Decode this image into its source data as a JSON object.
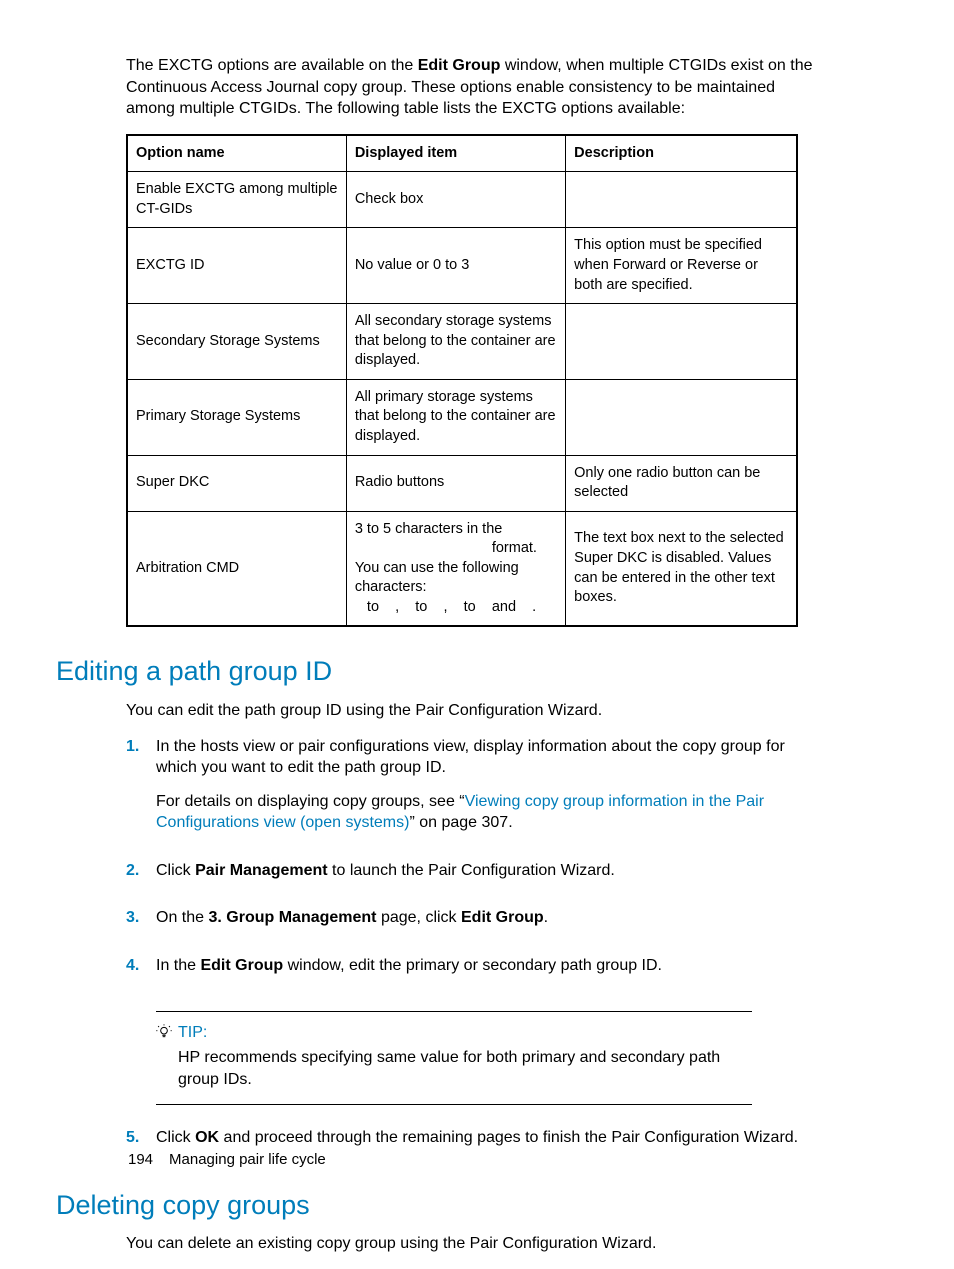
{
  "intro": {
    "line1_prefix": "The EXCTG options are available on the ",
    "line1_bold": "Edit Group",
    "line1_suffix": " window, when multiple CTGIDs exist on the Continuous Access Journal copy group. These options enable consistency to be maintained among multiple CTGIDs. The following table lists the EXCTG options available:"
  },
  "table": {
    "headers": {
      "c1": "Option name",
      "c2": "Displayed item",
      "c3": "Description"
    },
    "rows": [
      {
        "c1": "Enable EXCTG among multiple CT-GIDs",
        "c2": "Check box",
        "c3": ""
      },
      {
        "c1": "EXCTG ID",
        "c2": "No value or 0 to 3",
        "c3": "This option must be specified when Forward or Reverse or both are specified."
      },
      {
        "c1": "Secondary Storage Systems",
        "c2": "All secondary storage systems that belong to the container are displayed.",
        "c3": ""
      },
      {
        "c1": "Primary Storage Systems",
        "c2": "All primary storage systems that belong to the container are displayed.",
        "c3": ""
      },
      {
        "c1": "Super DKC",
        "c2": "Radio buttons",
        "c3": "Only one radio button can be selected"
      },
      {
        "c1": "Arbitration CMD",
        "c2": "3 to 5 characters in the\n                                  format. You can use the following characters:\n   to    ,    to    ,    to    and    .",
        "c3": "The text box next to the selected Super DKC is disabled. Values can be entered in the other text boxes."
      }
    ]
  },
  "section1": {
    "title": "Editing a path group ID",
    "intro": "You can edit the path group ID using the Pair Configuration Wizard.",
    "steps": {
      "s1": "In the hosts view or pair configurations view, display information about the copy group for which you want to edit the path group ID.",
      "s1b_prefix": "For details on displaying copy groups, see “",
      "s1b_link": "Viewing copy group information in the Pair Configurations view (open systems)",
      "s1b_suffix": "” on page 307.",
      "s2_prefix": "Click ",
      "s2_bold": "Pair Management",
      "s2_suffix": " to launch the Pair Configuration Wizard.",
      "s3_prefix": "On the ",
      "s3_bold1": "3. Group Management",
      "s3_mid": " page, click ",
      "s3_bold2": "Edit Group",
      "s3_suffix": ".",
      "s4_prefix": "In the ",
      "s4_bold": "Edit Group",
      "s4_suffix": " window, edit the primary or secondary path group ID.",
      "s5_prefix": "Click ",
      "s5_bold": "OK",
      "s5_suffix": " and proceed through the remaining pages to finish the Pair Configuration Wizard."
    },
    "tip": {
      "label": "TIP:",
      "text": "HP recommends specifying same value for both primary and secondary path group IDs."
    }
  },
  "section2": {
    "title": "Deleting copy groups",
    "intro": "You can delete an existing copy group using the Pair Configuration Wizard."
  },
  "nums": {
    "n1": "1.",
    "n2": "2.",
    "n3": "3.",
    "n4": "4.",
    "n5": "5."
  },
  "footer": {
    "page": "194",
    "chapter": "Managing pair life cycle"
  }
}
